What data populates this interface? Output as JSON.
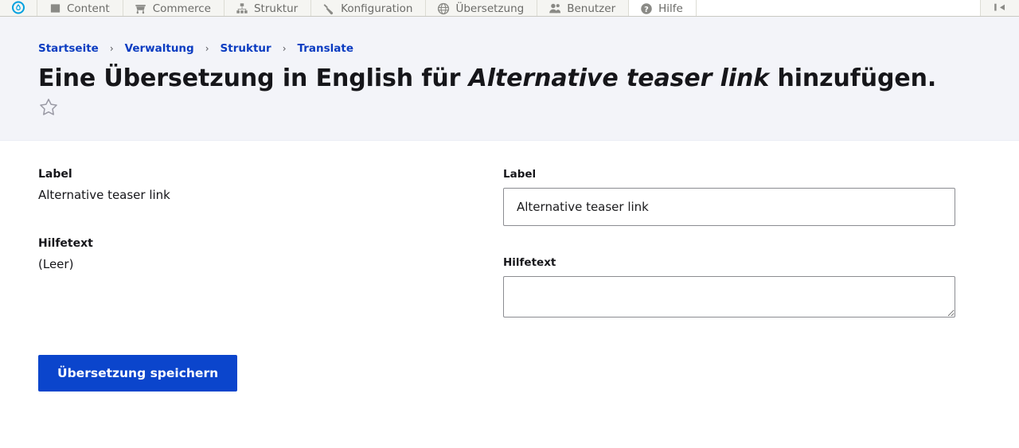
{
  "toolbar": {
    "home_icon": "drupal-droplet-logo",
    "items": [
      {
        "label": "Content",
        "icon": "content-icon",
        "active": false
      },
      {
        "label": "Commerce",
        "icon": "cart-icon",
        "active": false
      },
      {
        "label": "Struktur",
        "icon": "sitemap-icon",
        "active": false
      },
      {
        "label": "Konfiguration",
        "icon": "wrench-icon",
        "active": false
      },
      {
        "label": "Übersetzung",
        "icon": "globe-icon",
        "active": false
      },
      {
        "label": "Benutzer",
        "icon": "people-icon",
        "active": false
      },
      {
        "label": "Hilfe",
        "icon": "help-icon",
        "active": true
      }
    ],
    "right_icon": "collapse-toolbar-icon"
  },
  "breadcrumb": {
    "items": [
      "Startseite",
      "Verwaltung",
      "Struktur",
      "Translate"
    ],
    "separator": "›"
  },
  "header": {
    "title_before": "Eine Übersetzung in English für ",
    "title_emphasis": "Alternative teaser link",
    "title_after": " hinzufügen.",
    "star_icon": "star-outline-icon",
    "band_color": "#f3f4f9"
  },
  "source": {
    "label_heading": "Label",
    "label_value": "Alternative teaser link",
    "help_heading": "Hilfetext",
    "help_value": "(Leer)"
  },
  "form": {
    "label_field": {
      "label": "Label",
      "value": "Alternative teaser link",
      "placeholder": ""
    },
    "help_field": {
      "label": "Hilfetext",
      "value": "",
      "placeholder": ""
    },
    "submit_label": "Übersetzung speichern",
    "submit_color": "#0b45cc"
  }
}
